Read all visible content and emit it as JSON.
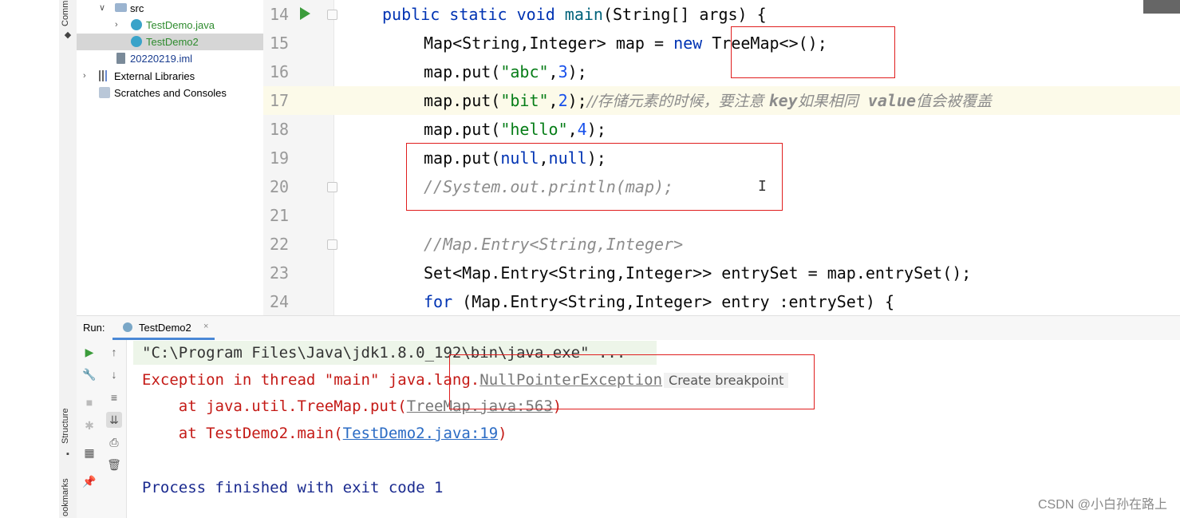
{
  "left_strip": {
    "top_label": "Comm",
    "structure_label": "Structure",
    "bookmarks_label": "ookmarks"
  },
  "project_tree": {
    "items": [
      {
        "label": "src",
        "kind": "folder",
        "expanded": true
      },
      {
        "label": "TestDemo.java",
        "kind": "java-class"
      },
      {
        "label": "TestDemo2",
        "kind": "java-class",
        "selected": true
      },
      {
        "label": "20220219.iml",
        "kind": "iml-file"
      },
      {
        "label": "External Libraries",
        "kind": "libraries"
      },
      {
        "label": "Scratches and Consoles",
        "kind": "scratches"
      }
    ]
  },
  "editor": {
    "lines": [
      {
        "n": "14",
        "parts": [
          "public static void ",
          "main",
          "(String[] args) {"
        ]
      },
      {
        "n": "15",
        "parts": [
          "Map<String,Integer> map = ",
          "new",
          " TreeMap<>();"
        ]
      },
      {
        "n": "16",
        "parts": [
          "map.put(",
          "\"abc\"",
          ",",
          "3",
          ");"
        ]
      },
      {
        "n": "17",
        "parts": [
          "map.put(",
          "\"bit\"",
          ",",
          "2",
          ");",
          "//存储元素的时候，要注意 ",
          "key",
          "如果相同  ",
          "value",
          "值会被覆盖"
        ]
      },
      {
        "n": "18",
        "parts": [
          "map.put(",
          "\"hello\"",
          ",",
          "4",
          ");"
        ]
      },
      {
        "n": "19",
        "parts": [
          "map.put(",
          "null",
          ",",
          "null",
          ");"
        ]
      },
      {
        "n": "20",
        "parts": [
          "//System.out.println(map);"
        ]
      },
      {
        "n": "21",
        "parts": [
          ""
        ]
      },
      {
        "n": "22",
        "parts": [
          "//Map.Entry<String,Integer>"
        ]
      },
      {
        "n": "23",
        "parts": [
          "Set<Map.Entry<String,Integer>> entrySet = map.entrySet();"
        ]
      },
      {
        "n": "24",
        "parts": [
          "for",
          " (Map.Entry<String,Integer> entry :entrySet) {"
        ]
      }
    ]
  },
  "run_panel": {
    "label": "Run:",
    "tab": "TestDemo2",
    "console": {
      "cmd": "\"C:\\Program Files\\Java\\jdk1.8.0_192\\bin\\java.exe\" ...",
      "exc_prefix": "Exception in thread \"main\" java.lang.",
      "exc_link": "NullPointerException",
      "bp_hint": "Create breakpoint",
      "trace1_prefix": "    at java.util.TreeMap.put(",
      "trace1_link": "TreeMap.java:563",
      "trace1_suffix": ")",
      "trace2_prefix": "    at TestDemo2.main(",
      "trace2_link": "TestDemo2.java:19",
      "trace2_suffix": ")",
      "finished": "Process finished with exit code 1"
    }
  },
  "watermark": "CSDN @小白孙在路上",
  "colors": {
    "keyword": "#0033b3",
    "string": "#067d17",
    "number": "#1750eb",
    "comment": "#8c8c8c",
    "error": "#c41a16",
    "link": "#2a6bc4",
    "annotation_box": "#e01e1e"
  }
}
